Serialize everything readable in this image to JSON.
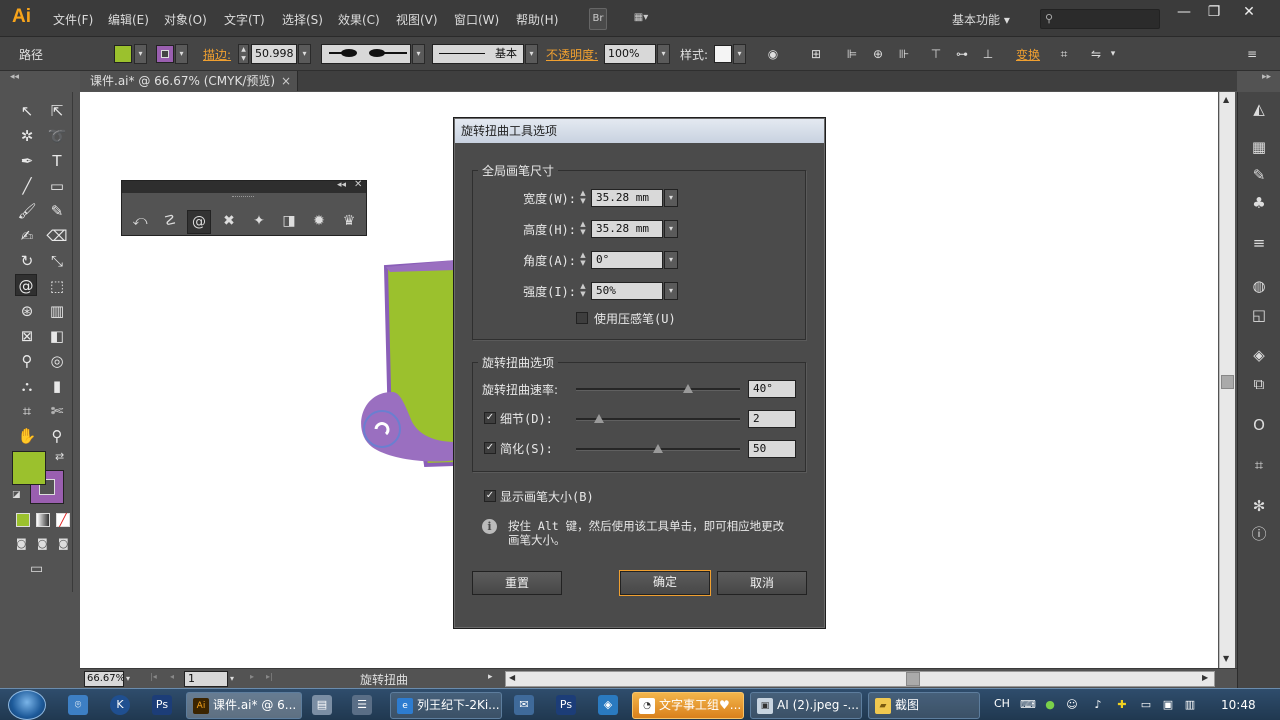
{
  "app": {
    "logo": "Ai"
  },
  "menu": [
    "文件(F)",
    "编辑(E)",
    "对象(O)",
    "文字(T)",
    "选择(S)",
    "效果(C)",
    "视图(V)",
    "窗口(W)",
    "帮助(H)"
  ],
  "menu_icons": {
    "bridge": "Br",
    "arrange": "▦▾"
  },
  "workspace": {
    "label": "基本功能",
    "search_placeholder": ""
  },
  "window_controls": {
    "minimize": "—",
    "restore": "❐",
    "close": "✕"
  },
  "control_bar": {
    "object_type": "路径",
    "stroke_label": "描边:",
    "stroke_weight": "50.998",
    "stroke_style": "基本",
    "opacity_label": "不透明度:",
    "opacity": "100%",
    "style_label": "样式:",
    "transform_label": "变换",
    "fill_color": "#9bc12d",
    "stroke_color": "#9a5fb0"
  },
  "document": {
    "tab_title": "课件.ai* @ 66.67% (CMYK/预览)",
    "close": "×"
  },
  "status_bar": {
    "zoom": "66.67%",
    "page": "1",
    "tool_name": "旋转扭曲"
  },
  "dialog": {
    "title": "旋转扭曲工具选项",
    "brush_group": "全局画笔尺寸",
    "width_label": "宽度(W):",
    "width_value": "35.28 mm",
    "height_label": "高度(H):",
    "height_value": "35.28 mm",
    "angle_label": "角度(A):",
    "angle_value": "0°",
    "intensity_label": "强度(I):",
    "intensity_value": "50%",
    "pressure_label": "使用压感笔(U)",
    "twirl_group": "旋转扭曲选项",
    "rate_label": "旋转扭曲速率:",
    "rate_value": "40°",
    "rate_level": 0.68,
    "detail_label": "细节(D):",
    "detail_value": "2",
    "detail_level": 0.14,
    "simplify_label": "简化(S):",
    "simplify_value": "50",
    "simplify_level": 0.5,
    "show_brush_label": "显示画笔大小(B)",
    "info_text_1": "按住 Alt 键，然后使用该工具单击，即可相应地更改",
    "info_text_2": "画笔大小。",
    "reset_button": "重置",
    "ok_button": "确定",
    "cancel_button": "取消"
  },
  "taskbar": {
    "items": [
      "课件.ai* @ 6...",
      "列王纪下-2Ki...",
      "文字事工组♥...",
      "AI (2).jpeg -...",
      "截图"
    ],
    "lang": "CH",
    "time": "10:48"
  }
}
